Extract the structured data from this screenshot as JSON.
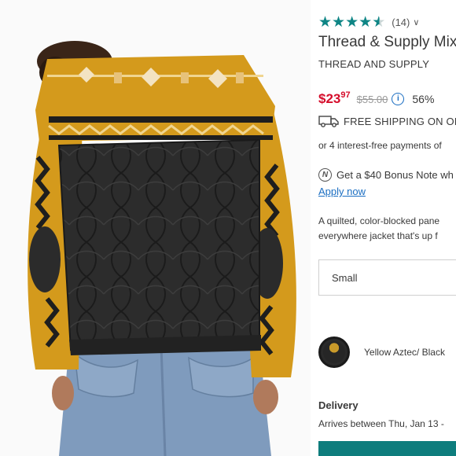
{
  "product": {
    "review_count": "(14)",
    "rating": 4.5,
    "rating_max": 5,
    "title": "Thread & Supply Mix",
    "brand": "THREAD AND SUPPLY",
    "sale_price_dollars": "$23",
    "sale_price_cents": "97",
    "original_price": "$55.00",
    "discount": "56%",
    "shipping": "FREE SHIPPING ON OR",
    "installments": "or 4 interest-free payments of",
    "bonus_note": "Get a $40 Bonus Note wh",
    "apply_link": "Apply now",
    "description_line1": "A quilted, color-blocked pane",
    "description_line2": "everywhere jacket that's up f",
    "size_selected": "Small",
    "color_label": "Yellow Aztec/ Black",
    "delivery_heading": "Delivery",
    "delivery_text": "Arrives between Thu, Jan 13 -"
  },
  "icons": {
    "star": "star-icon",
    "chevron": "chevron-down-icon",
    "info": "info-icon",
    "truck": "truck-icon",
    "note": "bonus-note-icon"
  },
  "colors": {
    "accent_teal": "#0e8585",
    "sale_red": "#d50d2b",
    "link_blue": "#1b6ec2",
    "jacket_yellow": "#d49a1c",
    "jacket_black": "#2b2b2b",
    "denim": "#7f9bbd"
  }
}
